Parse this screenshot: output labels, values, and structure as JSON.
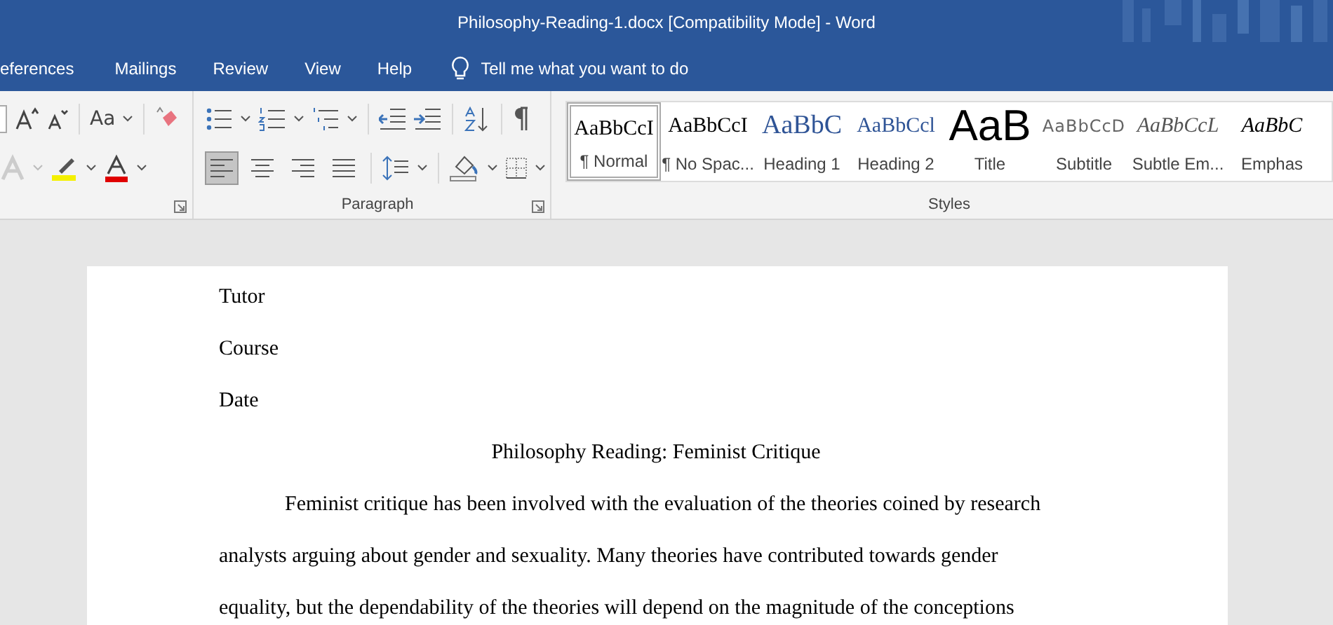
{
  "window": {
    "title": "Philosophy-Reading-1.docx [Compatibility Mode]  -  Word"
  },
  "tabs": [
    {
      "label": "eferences"
    },
    {
      "label": "Mailings"
    },
    {
      "label": "Review"
    },
    {
      "label": "View"
    },
    {
      "label": "Help"
    }
  ],
  "tell_me": {
    "placeholder": "Tell me what you want to do"
  },
  "font_group": {
    "change_case": "Aa"
  },
  "paragraph_group": {
    "label": "Paragraph",
    "align_buttons": [
      {
        "kind": "left",
        "selected": true
      },
      {
        "kind": "center",
        "selected": false
      },
      {
        "kind": "right",
        "selected": false
      },
      {
        "kind": "justify",
        "selected": false
      }
    ]
  },
  "styles_group": {
    "label": "Styles",
    "styles": [
      {
        "kind": "normal",
        "preview": "AaBbCcI",
        "label": "¶ Normal",
        "selected": true
      },
      {
        "kind": "no-spacing",
        "preview": "AaBbCcI",
        "label": "¶ No Spac...",
        "selected": false
      },
      {
        "kind": "heading1",
        "preview": "AaBbC",
        "label": "Heading 1",
        "selected": false
      },
      {
        "kind": "heading2",
        "preview": "AaBbCcl",
        "label": "Heading 2",
        "selected": false
      },
      {
        "kind": "title",
        "preview": "AaB",
        "label": "Title",
        "selected": false
      },
      {
        "kind": "subtitle",
        "preview": "AaBbCcD",
        "label": "Subtitle",
        "selected": false
      },
      {
        "kind": "subtle-emphasis",
        "preview": "AaBbCcL",
        "label": "Subtle Em...",
        "selected": false
      },
      {
        "kind": "emphasis",
        "preview": "AaBbC",
        "label": "Emphas",
        "selected": false
      }
    ]
  },
  "document": {
    "lines": [
      {
        "kind": "plain",
        "text": "Tutor"
      },
      {
        "kind": "plain",
        "text": "Course"
      },
      {
        "kind": "plain",
        "text": "Date"
      },
      {
        "kind": "title",
        "text": "Philosophy Reading: Feminist Critique"
      },
      {
        "kind": "paragraph",
        "text": "Feminist critique has been involved with the evaluation of the theories coined by research analysts arguing about gender and sexuality. Many theories have contributed towards gender equality, but the dependability of the theories will depend on the magnitude of the conceptions"
      }
    ]
  }
}
